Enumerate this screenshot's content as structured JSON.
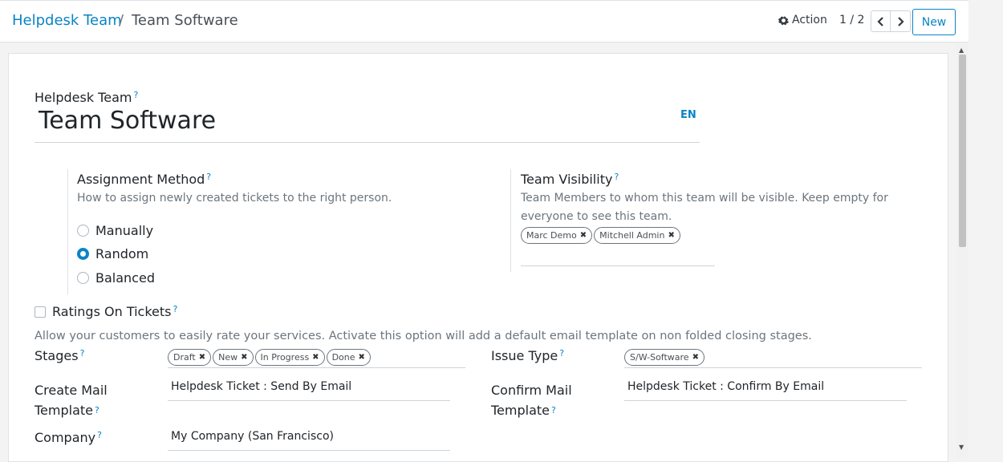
{
  "breadcrumb": {
    "parent": "Helpdesk Team",
    "separator": "/",
    "current": "Team Software"
  },
  "toolbar": {
    "action_label": "Action",
    "pager": "1 / 2",
    "new_label": "New"
  },
  "form": {
    "team_label": "Helpdesk Team",
    "help_mark": "?",
    "team_name": "Team Software",
    "lang": "EN",
    "assignment": {
      "label": "Assignment Method",
      "description": "How to assign newly created tickets to the right person.",
      "options": [
        "Manually",
        "Random",
        "Balanced"
      ],
      "selected": "Random"
    },
    "visibility": {
      "label": "Team Visibility",
      "description_line1": "Team Members to whom this team will be visible. Keep empty for",
      "description_line2": "everyone to see this team.",
      "tags": [
        "Marc Demo",
        "Mitchell Admin"
      ]
    },
    "ratings": {
      "label": "Ratings On Tickets",
      "checked": false,
      "description": "Allow your customers to easily rate your services. Activate this option will add a default email template on non folded closing stages."
    },
    "stages": {
      "label": "Stages",
      "tags": [
        "Draft",
        "New",
        "In Progress",
        "Done"
      ]
    },
    "issue_type": {
      "label": "Issue Type",
      "tags": [
        "S/W-Software"
      ]
    },
    "create_mail": {
      "label_line1": "Create Mail",
      "label_line2": "Template",
      "value": "Helpdesk Ticket : Send By Email"
    },
    "confirm_mail": {
      "label_line1": "Confirm Mail",
      "label_line2": "Template",
      "value": "Helpdesk Ticket : Confirm By Email"
    },
    "company": {
      "label": "Company",
      "value": "My Company (San Francisco)"
    }
  }
}
